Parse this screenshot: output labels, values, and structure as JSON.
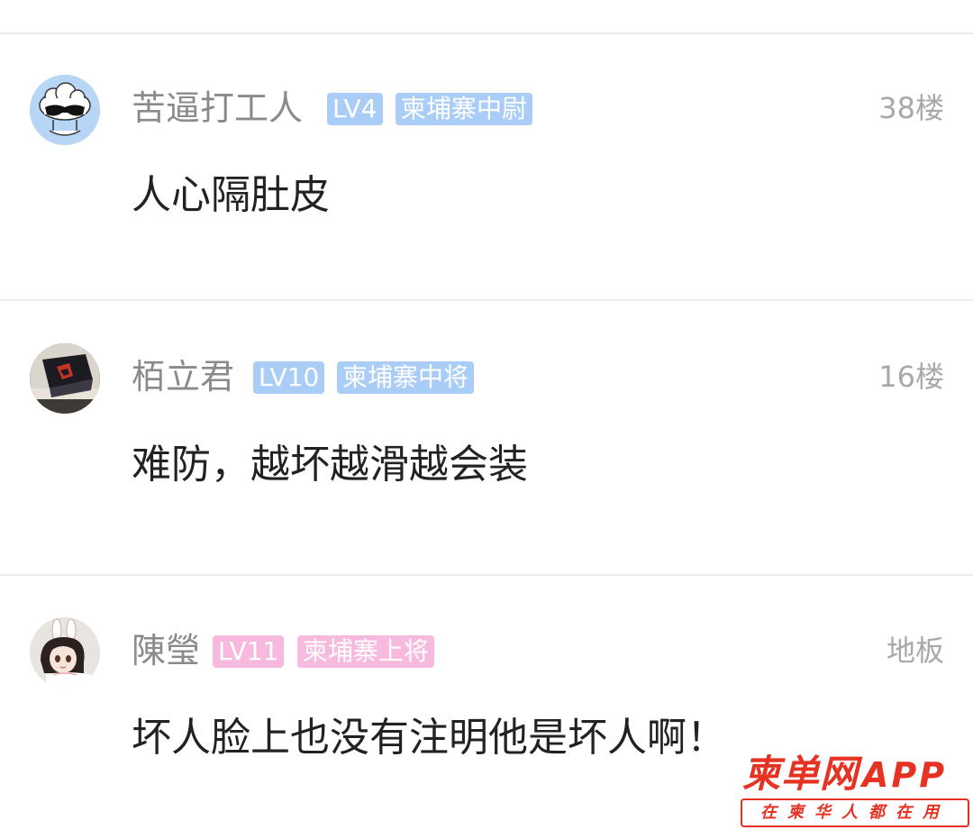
{
  "comments": [
    {
      "username": "苦逼打工人",
      "level": "LV4",
      "rank": "柬埔寨中尉",
      "floor": "38楼",
      "content": "人心隔肚皮",
      "avatar_icon": "cloud-sunglasses-avatar",
      "badge_color": "#a9cdf7"
    },
    {
      "username": "栢立君",
      "level": "LV10",
      "rank": "柬埔寨中将",
      "floor": "16楼",
      "content": "难防，越坏越滑越会装",
      "avatar_icon": "photo-avatar",
      "badge_color": "#a9cdf7"
    },
    {
      "username": "陳瑩",
      "level": "LV11",
      "rank": "柬埔寨上将",
      "floor": "地板",
      "content": "坏人脸上也没有注明他是坏人啊！",
      "avatar_icon": "anime-girl-avatar",
      "badge_color": "#f8b9de"
    }
  ],
  "watermark": {
    "brand": "柬单网",
    "app": "APP",
    "slogan": "在柬华人都在用",
    "color": "#e53222"
  }
}
